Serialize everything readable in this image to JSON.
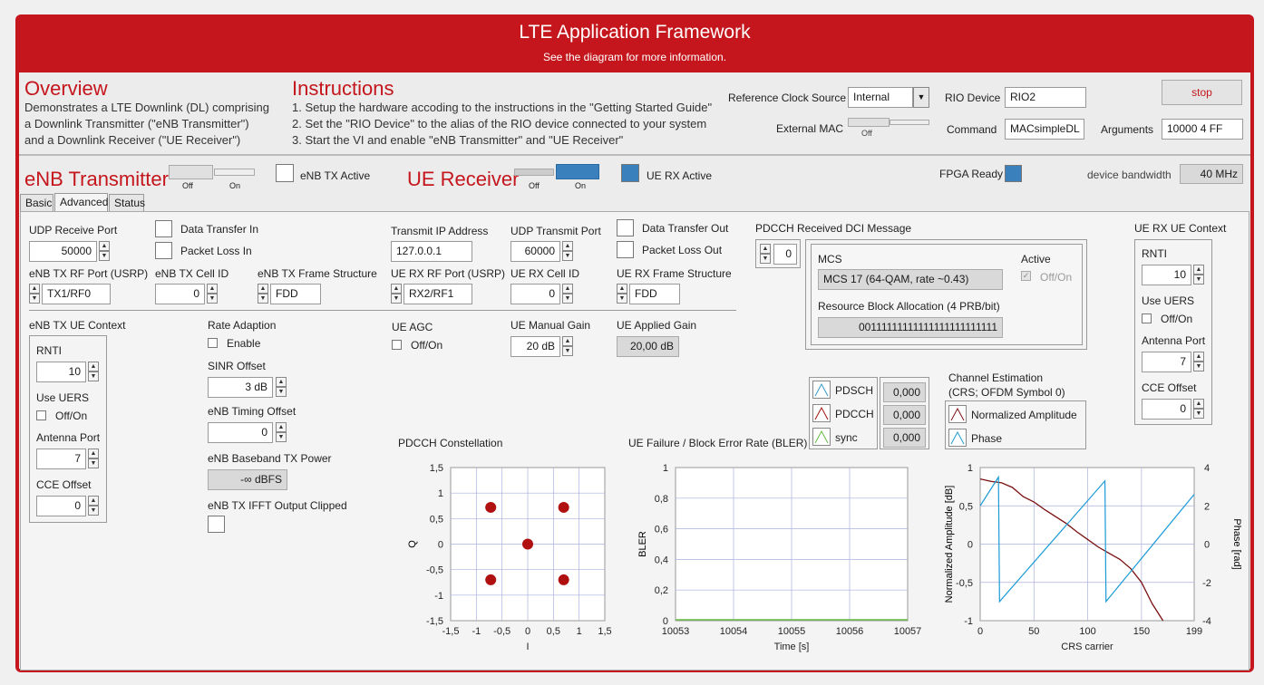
{
  "header": {
    "title": "LTE Application Framework",
    "subtitle": "See the diagram for more information."
  },
  "overview": {
    "heading": "Overview",
    "lines": [
      "Demonstrates a LTE Downlink (DL) comprising",
      "a Downlink Transmitter (\"eNB Transmitter\")",
      "and a Downlink Receiver (\"UE Receiver\")"
    ]
  },
  "instructions": {
    "heading": "Instructions",
    "lines": [
      "1. Setup the hardware accoding to the instructions in the \"Getting Started Guide\"",
      "2. Set the \"RIO Device\" to the alias of the RIO device connected to your system",
      "3. Start the VI and enable \"eNB Transmitter\" and \"UE Receiver\""
    ]
  },
  "config": {
    "ref_clock_label": "Reference Clock Source",
    "ref_clock_value": "Internal",
    "ext_mac_label": "External MAC",
    "ext_mac_state": "Off",
    "rio_label": "RIO Device",
    "rio_value": "RIO2",
    "command_label": "Command",
    "command_value": "MACsimpleDL",
    "args_label": "Arguments",
    "args_value": "10000 4 FF",
    "stop_label": "stop"
  },
  "enb": {
    "heading": "eNB Transmitter",
    "off": "Off",
    "on": "On",
    "active_label": "eNB TX Active",
    "active": false
  },
  "ue": {
    "heading": "UE Receiver",
    "off": "Off",
    "on": "On",
    "active_label": "UE RX Active",
    "active": true
  },
  "fpga": {
    "label": "FPGA Ready",
    "ready": true
  },
  "bandwidth": {
    "label": "device bandwidth",
    "value": "40 MHz"
  },
  "tabs": [
    "Basic",
    "Advanced",
    "Status"
  ],
  "active_tab": "Advanced",
  "adv": {
    "udp_rx_label": "UDP Receive Port",
    "udp_rx_value": "50000",
    "data_in_label": "Data Transfer In",
    "loss_in_label": "Packet Loss In",
    "tx_ip_label": "Transmit IP Address",
    "tx_ip_value": "127.0.0.1",
    "udp_tx_label": "UDP Transmit Port",
    "udp_tx_value": "60000",
    "data_out_label": "Data Transfer Out",
    "loss_out_label": "Packet Loss Out",
    "enb_rf_label": "eNB TX RF Port (USRP)",
    "enb_rf_value": "TX1/RF0",
    "enb_cell_label": "eNB TX Cell ID",
    "enb_cell_value": "0",
    "enb_frame_label": "eNB TX Frame Structure",
    "enb_frame_value": "FDD",
    "ue_rf_label": "UE RX RF Port (USRP)",
    "ue_rf_value": "RX2/RF1",
    "ue_cell_label": "UE RX Cell ID",
    "ue_cell_value": "0",
    "ue_frame_label": "UE RX Frame Structure",
    "ue_frame_value": "FDD",
    "enb_ue_ctx_label": "eNB TX UE Context",
    "rnti_label": "RNTI",
    "rnti_value": "10",
    "uers_label": "Use UERS",
    "uers_check": "Off/On",
    "antenna_label": "Antenna Port",
    "antenna_value": "7",
    "cce_label": "CCE Offset",
    "cce_value": "0",
    "rate_label": "Rate Adaption",
    "rate_check": "Enable",
    "sinr_label": "SINR Offset",
    "sinr_value": "3 dB",
    "timing_label": "eNB Timing Offset",
    "timing_value": "0",
    "bb_power_label": "eNB Baseband TX Power",
    "bb_power_value": "-∞ dBFS",
    "ifft_label": "eNB TX IFFT Output Clipped",
    "agc_label": "UE AGC",
    "agc_check": "Off/On",
    "manual_gain_label": "UE Manual Gain",
    "manual_gain_value": "20 dB",
    "applied_gain_label": "UE Applied Gain",
    "applied_gain_value": "20,00 dB",
    "pdcch_dci_label": "PDCCH Received DCI Message",
    "pdcch_index": "0",
    "mcs_label": "MCS",
    "mcs_value": "MCS 17 (64-QAM, rate ~0.43)",
    "active_label": "Active",
    "active_check": "Off/On",
    "rba_label": "Resource Block Allocation (4 PRB/bit)",
    "rba_value": "00111111111111111111111111",
    "ue_rx_ctx_label": "UE RX UE Context",
    "ue_rnti_value": "10",
    "ue_antenna_value": "7",
    "ue_cce_value": "0"
  },
  "crc": {
    "items": [
      {
        "name": "PDSCH",
        "value": "0,000",
        "color": "#3399cc"
      },
      {
        "name": "PDCCH",
        "value": "0,000",
        "color": "#a01010"
      },
      {
        "name": "sync",
        "value": "0,000",
        "color": "#66bb44"
      }
    ]
  },
  "channel_est": {
    "title": "Channel Estimation",
    "subtitle": "(CRS; OFDM Symbol 0)",
    "legend": [
      {
        "name": "Normalized Amplitude",
        "color": "#7a1010"
      },
      {
        "name": "Phase",
        "color": "#1a9ad6"
      }
    ]
  },
  "constellation": {
    "title": "PDCCH Constellation",
    "xlabel": "I",
    "ylabel": "Q",
    "xticks": [
      "-1,5",
      "-1",
      "-0,5",
      "0",
      "0,5",
      "1",
      "1,5"
    ],
    "yticks": [
      "1,5",
      "1",
      "0,5",
      "0",
      "-0,5",
      "-1",
      "-1,5"
    ]
  },
  "bler": {
    "title": "UE Failure / Block Error Rate (BLER)",
    "xlabel": "Time [s]",
    "ylabel": "BLER",
    "xticks": [
      "10053",
      "10054",
      "10055",
      "10056",
      "10057"
    ],
    "yticks": [
      "1",
      "0,8",
      "0,6",
      "0,4",
      "0,2",
      "0"
    ]
  },
  "chplot": {
    "xlabel": "CRS carrier",
    "ylabel": "Normalized Amplitude [dB]",
    "y2label": "Phase [rad]",
    "xticks": [
      "0",
      "50",
      "100",
      "150",
      "199"
    ],
    "yticks": [
      "1",
      "0,5",
      "0",
      "-0,5",
      "-1"
    ],
    "y2ticks": [
      "4",
      "2",
      "0",
      "-2",
      "-4"
    ]
  },
  "chart_data": [
    {
      "type": "scatter",
      "title": "PDCCH Constellation",
      "xlabel": "I",
      "ylabel": "Q",
      "xlim": [
        -1.5,
        1.5
      ],
      "ylim": [
        -1.5,
        1.5
      ],
      "series": [
        {
          "x": [
            -0.72,
            0.7,
            -0.72,
            0.7,
            0
          ],
          "y": [
            0.72,
            0.72,
            -0.7,
            -0.7,
            0
          ]
        }
      ],
      "color": "#b01010"
    },
    {
      "type": "line",
      "title": "UE Failure / Block Error Rate (BLER)",
      "xlabel": "Time [s]",
      "ylabel": "BLER",
      "xlim": [
        10053,
        10057
      ],
      "ylim": [
        0,
        1
      ],
      "series": [
        {
          "x": [
            10053,
            10057
          ],
          "y": [
            0,
            0
          ]
        }
      ],
      "color": "#66bb44"
    },
    {
      "type": "line",
      "xlabel": "CRS carrier",
      "ylabel": "Normalized Amplitude [dB]",
      "y2label": "Phase [rad]",
      "xlim": [
        0,
        199
      ],
      "ylim": [
        -1,
        1
      ],
      "y2lim": [
        -4,
        4
      ],
      "series": [
        {
          "name": "Normalized Amplitude",
          "axis": "left",
          "x": [
            0,
            10,
            20,
            30,
            40,
            50,
            60,
            70,
            80,
            90,
            100,
            110,
            120,
            130,
            140,
            150,
            160,
            170
          ],
          "y": [
            0.85,
            0.82,
            0.8,
            0.74,
            0.62,
            0.55,
            0.45,
            0.36,
            0.27,
            0.16,
            0.06,
            -0.04,
            -0.12,
            -0.2,
            -0.32,
            -0.5,
            -0.78,
            -1.0
          ]
        },
        {
          "name": "Phase",
          "axis": "right",
          "x": [
            0,
            17,
            18,
            116,
            117,
            199
          ],
          "y": [
            2.0,
            3.5,
            -3.0,
            3.3,
            -3.0,
            2.6
          ]
        }
      ]
    }
  ]
}
